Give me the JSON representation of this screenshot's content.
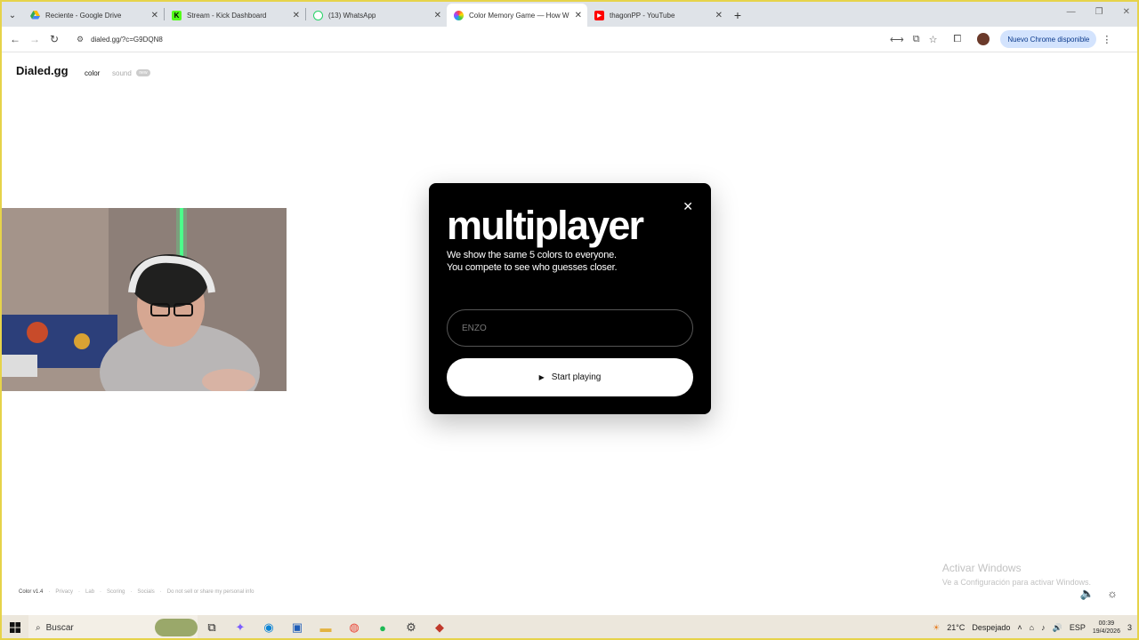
{
  "browser": {
    "tabs": [
      {
        "title": "Reciente - Google Drive",
        "icon": "google-drive-icon",
        "color": "#34a853"
      },
      {
        "title": "Stream - Kick Dashboard",
        "icon": "kick-icon",
        "color": "#1a1a1a"
      },
      {
        "title": "(13) WhatsApp",
        "icon": "whatsapp-icon",
        "color": "#25d366"
      },
      {
        "title": "Color Memory Game — How W",
        "icon": "color-wheel-icon",
        "color": "#e04a8a"
      },
      {
        "title": "thagonPP - YouTube",
        "icon": "youtube-icon",
        "color": "#ff0000"
      }
    ],
    "address": "dialed.gg/?c=G9DQN8",
    "update_label": "Nuevo Chrome disponible"
  },
  "site": {
    "brand": "Dialed.gg",
    "nav_color": "color",
    "nav_sound": "sound",
    "sound_badge": "new"
  },
  "modal": {
    "title": "multiplayer",
    "subtitle_line1": "We show the same 5 colors to everyone.",
    "subtitle_line2": "You compete to see who guesses closer.",
    "name_placeholder": "ENZO",
    "start_label": "Start playing"
  },
  "footer": {
    "version": "Color v1.4",
    "links": [
      "Privacy",
      "Lab",
      "Scoring",
      "Socials",
      "Do not sell or share my personal info"
    ]
  },
  "watermark": {
    "line1": "Activar Windows",
    "line2": "Ve a Configuración para activar Windows."
  },
  "taskbar": {
    "search_label": "Buscar",
    "weather_temp": "21°C",
    "weather_desc": "Despejado",
    "lang": "ESP",
    "time": "00:39",
    "date": "19/4/2026",
    "notif_count": "3"
  },
  "colors": {
    "modal_bg": "#000000",
    "accent_border": "#e6d34a"
  }
}
